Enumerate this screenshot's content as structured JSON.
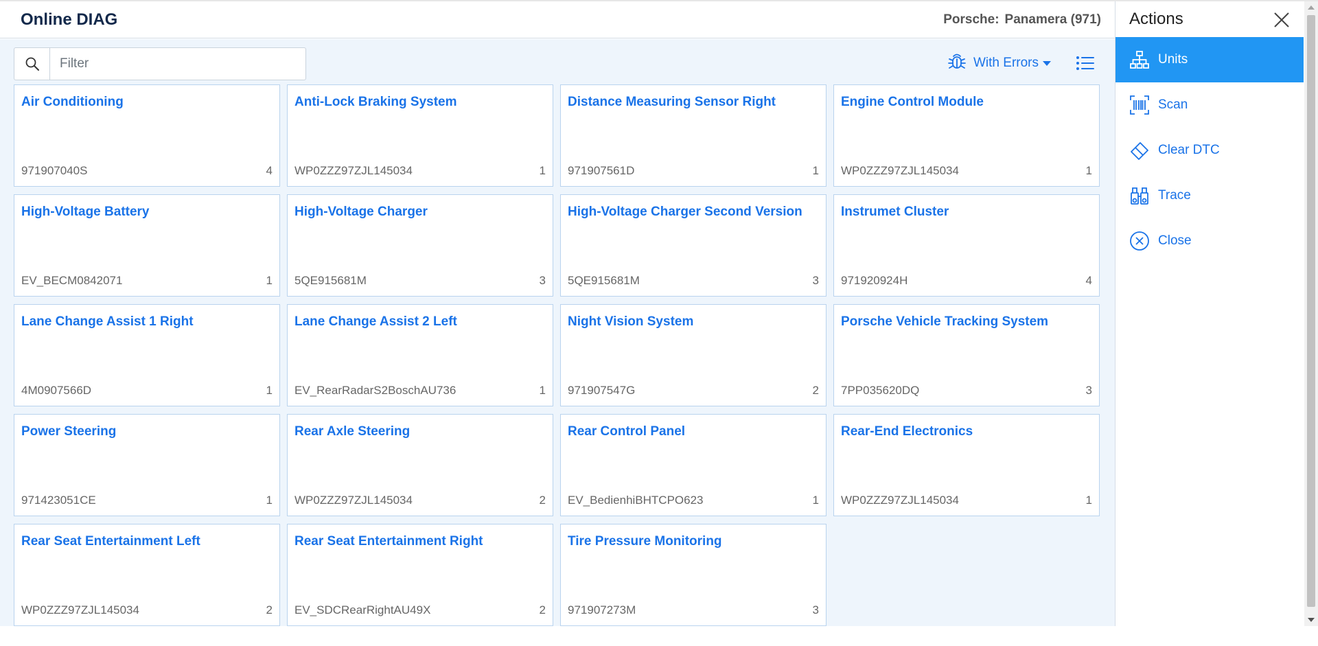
{
  "header": {
    "app_title": "Online DIAG",
    "vehicle_brand": "Porsche:",
    "vehicle_model": "Panamera (971)"
  },
  "search": {
    "placeholder": "Filter",
    "value": ""
  },
  "toolbar": {
    "filter_label": "With Errors"
  },
  "units": [
    {
      "name": "Air Conditioning",
      "code": "971907040S",
      "count": "4"
    },
    {
      "name": "Anti-Lock Braking System",
      "code": "WP0ZZZ97ZJL145034",
      "count": "1"
    },
    {
      "name": "Distance Measuring Sensor Right",
      "code": "971907561D",
      "count": "1"
    },
    {
      "name": "Engine Control Module",
      "code": "WP0ZZZ97ZJL145034",
      "count": "1"
    },
    {
      "name": "High-Voltage Battery",
      "code": "EV_BECM0842071",
      "count": "1"
    },
    {
      "name": "High-Voltage Charger",
      "code": "5QE915681M",
      "count": "3"
    },
    {
      "name": "High-Voltage Charger Second Version",
      "code": "5QE915681M",
      "count": "3"
    },
    {
      "name": "Instrumet Cluster",
      "code": "971920924H",
      "count": "4"
    },
    {
      "name": "Lane Change Assist 1 Right",
      "code": "4M0907566D",
      "count": "1"
    },
    {
      "name": "Lane Change Assist 2 Left",
      "code": "EV_RearRadarS2BoschAU736",
      "count": "1"
    },
    {
      "name": "Night Vision System",
      "code": "971907547G",
      "count": "2"
    },
    {
      "name": "Porsche Vehicle Tracking System",
      "code": "7PP035620DQ",
      "count": "3"
    },
    {
      "name": "Power Steering",
      "code": "971423051CE",
      "count": "1"
    },
    {
      "name": "Rear Axle Steering",
      "code": "WP0ZZZ97ZJL145034",
      "count": "2"
    },
    {
      "name": "Rear Control Panel",
      "code": "EV_BedienhiBHTCPO623",
      "count": "1"
    },
    {
      "name": "Rear-End Electronics",
      "code": "WP0ZZZ97ZJL145034",
      "count": "1"
    },
    {
      "name": "Rear Seat Entertainment Left",
      "code": "WP0ZZZ97ZJL145034",
      "count": "2"
    },
    {
      "name": "Rear Seat Entertainment Right",
      "code": "EV_SDCRearRightAU49X",
      "count": "2"
    },
    {
      "name": "Tire Pressure Monitoring",
      "code": "971907273M",
      "count": "3"
    }
  ],
  "actions": {
    "title": "Actions",
    "items": [
      {
        "label": "Units",
        "icon": "sitemap-icon",
        "active": true
      },
      {
        "label": "Scan",
        "icon": "barcode-scan-icon",
        "active": false
      },
      {
        "label": "Clear DTC",
        "icon": "eraser-icon",
        "active": false
      },
      {
        "label": "Trace",
        "icon": "binoculars-icon",
        "active": false
      },
      {
        "label": "Close",
        "icon": "close-circle-icon",
        "active": false
      }
    ]
  },
  "colors": {
    "accent": "#1a73e8",
    "active_bg": "#2196f3",
    "main_bg": "#eef5fc",
    "card_border": "#b9d3ee",
    "title": "#13294b"
  }
}
